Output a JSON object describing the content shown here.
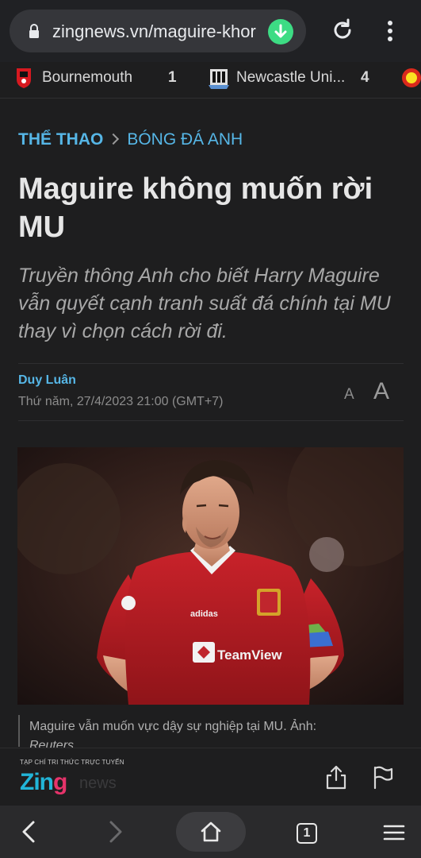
{
  "browser": {
    "url": "zingnews.vn/maguire-khor",
    "tab_count": "1"
  },
  "ticker": {
    "matches": [
      {
        "team": "Bournemouth",
        "score": "1"
      },
      {
        "team": "Newcastle Uni...",
        "score": "4"
      }
    ]
  },
  "article": {
    "breadcrumb": [
      "THỂ THAO",
      "BÓNG ĐÁ ANH"
    ],
    "title": "Maguire không muốn rời MU",
    "sapo": "Truyền thông Anh cho biết Harry Maguire vẫn quyết cạnh tranh suất đá chính tại MU thay vì chọn cách rời đi.",
    "author": "Duy Luân",
    "date": "Thứ năm, 27/4/2023 21:00 (GMT+7)",
    "font_small_label": "A",
    "font_large_label": "A",
    "image": {
      "jersey_text": "TeamView",
      "sleeve_text": "adidas",
      "caption": "Maguire vẫn muốn vực dậy sự nghiệp tại MU. Ảnh:",
      "caption_source": "Reuters"
    }
  },
  "brand": {
    "tagline": "TẠP CHÍ TRI THỨC TRỰC TUYẾN",
    "logo_z": "Zin",
    "logo_g": "g",
    "logo_news": "news"
  },
  "colors": {
    "accent": "#56b6e6",
    "background": "#1e1e1f",
    "download_badge": "#3ddc84",
    "logo_blue": "#22b5d8",
    "logo_pink": "#e6336a"
  }
}
